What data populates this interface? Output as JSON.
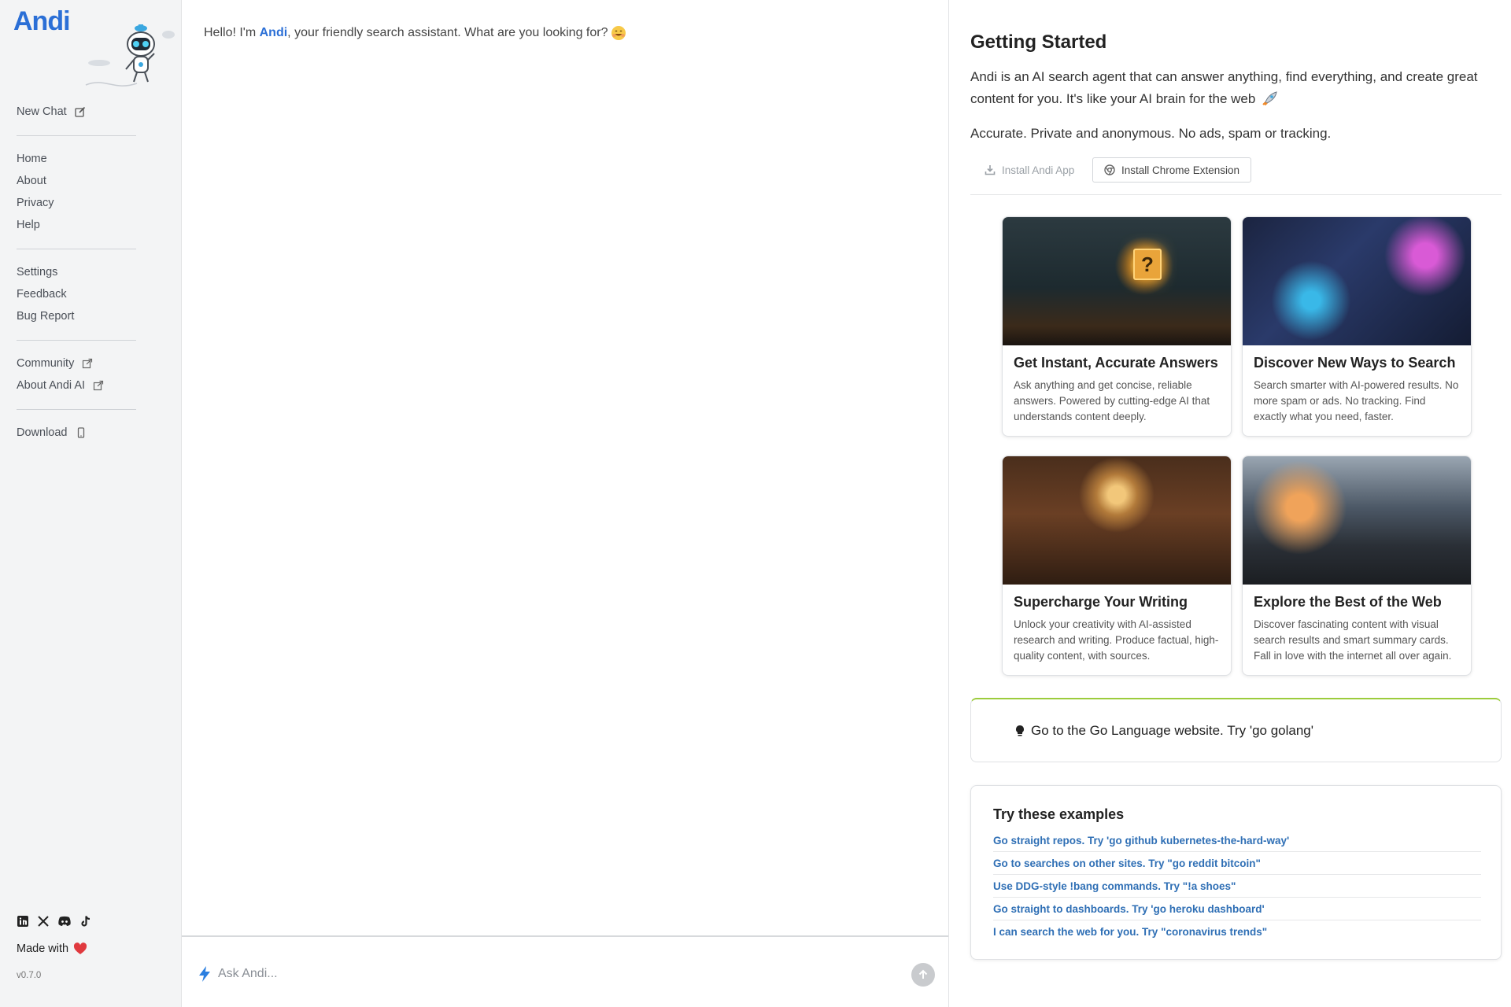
{
  "sidebar": {
    "logo": "Andi",
    "new_chat": "New Chat",
    "group1": [
      "Home",
      "About",
      "Privacy",
      "Help"
    ],
    "group2": [
      "Settings",
      "Feedback",
      "Bug Report"
    ],
    "community": "Community",
    "about_andi_ai": "About Andi AI",
    "download": "Download",
    "made_with": "Made with",
    "version": "v0.7.0"
  },
  "main": {
    "greeting_pre": "Hello! I'm ",
    "greeting_brand": "Andi",
    "greeting_post": ", your friendly search assistant. What are you looking for?",
    "input_placeholder": "Ask Andi..."
  },
  "panel": {
    "title": "Getting Started",
    "description": "Andi is an AI search agent that can answer anything, find everything, and create great content for you. It's like your AI brain for the web",
    "tagline": "Accurate. Private and anonymous. No ads, spam or tracking.",
    "install_app": "Install Andi App",
    "install_ext": "Install Chrome Extension",
    "cards": [
      {
        "title": "Get Instant, Accurate Answers",
        "text": "Ask anything and get concise, reliable answers. Powered by cutting-edge AI that understands content deeply."
      },
      {
        "title": "Discover New Ways to Search",
        "text": "Search smarter with AI-powered results. No more spam or ads. No tracking. Find exactly what you need, faster."
      },
      {
        "title": "Supercharge Your Writing",
        "text": "Unlock your creativity with AI-assisted research and writing. Produce factual, high-quality content, with sources."
      },
      {
        "title": "Explore the Best of the Web",
        "text": "Discover fascinating content with visual search results and smart summary cards. Fall in love with the internet all over again."
      }
    ],
    "tip": "Go to the Go Language website. Try 'go golang'",
    "examples_title": "Try these examples",
    "examples": [
      "Go straight repos. Try 'go github kubernetes-the-hard-way'",
      "Go to searches on other sites. Try \"go reddit bitcoin\"",
      "Use DDG-style !bang commands. Try \"!a shoes\"",
      "Go straight to dashboards. Try 'go heroku dashboard'",
      "I can search the web for you. Try \"coronavirus trends\""
    ]
  },
  "colors": {
    "brand_blue": "#2b6fd6",
    "link_blue": "#2f6fb5",
    "tip_accent": "#9ccc3c",
    "heart": "#e0393e"
  },
  "icons": [
    "edit-icon",
    "external-link-icon",
    "phone-icon",
    "linkedin-icon",
    "x-icon",
    "discord-icon",
    "tiktok-icon",
    "heart-icon",
    "bolt-icon",
    "arrow-up-icon",
    "download-icon",
    "chrome-icon",
    "bulb-icon",
    "rocket-icon",
    "smile-icon"
  ]
}
